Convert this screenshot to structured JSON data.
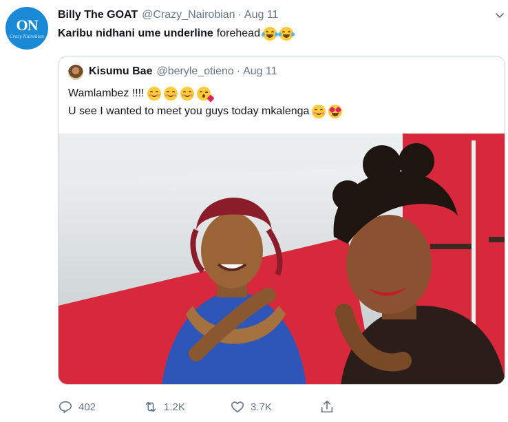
{
  "tweet": {
    "author_name": "Billy The GOAT",
    "handle": "@Crazy_Nairobian",
    "separator": "·",
    "date": "Aug 11",
    "avatar_monogram": "ON",
    "avatar_tagline": "Crazy Nairobian",
    "text_bold": "Karibu nidhani ume underline",
    "text_normal": "forehead",
    "text_emojis": [
      "face-with-tears-of-joy",
      "face-with-tears-of-joy"
    ]
  },
  "quoted": {
    "author_name": "Kisumu Bae",
    "handle": "@beryle_otieno",
    "separator": "·",
    "date": "Aug 11",
    "line1": "Wamlambez !!!!",
    "line1_emojis": [
      "smiling-face-with-smiling-eyes",
      "smiling-face-with-smiling-eyes",
      "smiling-face-with-smiling-eyes",
      "face-blowing-a-kiss"
    ],
    "line2": "U see I wanted to meet you guys today mkalenga",
    "line2_emojis": [
      "smiling-face",
      "heart-eyes"
    ]
  },
  "actions": {
    "replies": "402",
    "retweets": "1.2K",
    "likes": "3.7K"
  },
  "colors": {
    "text": "#14171a",
    "muted": "#657786",
    "border": "#cdd6dd",
    "avatar_blue": "#1b8ad6",
    "tent_red": "#d8283c"
  }
}
